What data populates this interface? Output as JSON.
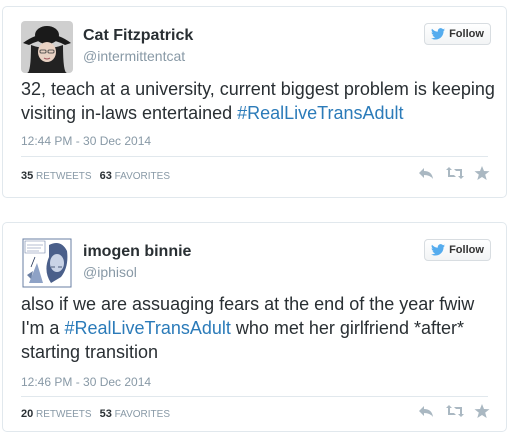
{
  "tweets": [
    {
      "display_name": "Cat Fitzpatrick",
      "screen_name": "@intermittentcat",
      "follow_label": "Follow",
      "text_before": "32, teach at a university, current biggest problem is keeping visiting in-laws entertained ",
      "hashtag": "#RealLiveTransAdult",
      "text_after": "",
      "timestamp": "12:44 PM - 30 Dec 2014",
      "retweets": "35",
      "retweets_label": "RETWEETS",
      "favorites": "63",
      "favorites_label": "FAVORITES"
    },
    {
      "display_name": "imogen binnie",
      "screen_name": "@iphisol",
      "follow_label": "Follow",
      "text_before": "also if we are assuaging fears at the end of the year fwiw I'm a ",
      "hashtag": "#RealLiveTransAdult",
      "text_after": " who met her girlfriend *after* starting transition",
      "timestamp": "12:46 PM - 30 Dec 2014",
      "retweets": "20",
      "retweets_label": "RETWEETS",
      "favorites": "53",
      "favorites_label": "FAVORITES"
    }
  ],
  "colors": {
    "link": "#2b7bb9",
    "muted": "#8899a6",
    "border": "#e1e8ed",
    "twitter_bird": "#55acee"
  },
  "icons": [
    "twitter-bird-icon",
    "reply-icon",
    "retweet-icon",
    "favorite-star-icon"
  ]
}
